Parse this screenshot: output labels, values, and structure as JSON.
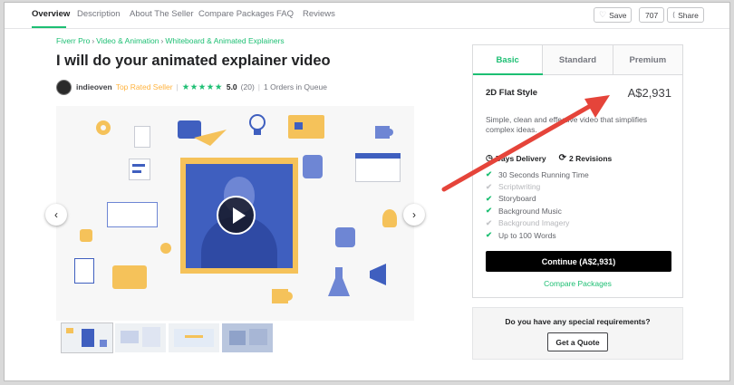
{
  "nav": {
    "tabs": [
      "Overview",
      "Description",
      "About The Seller",
      "Compare Packages",
      "FAQ",
      "Reviews"
    ],
    "save_label": "Save",
    "count": "707",
    "share_label": "Share"
  },
  "breadcrumb": [
    "Fiverr Pro",
    "Video & Animation",
    "Whiteboard & Animated Explainers"
  ],
  "title": "I will do your animated explainer video",
  "seller": {
    "name": "indieoven",
    "level": "Top Rated Seller",
    "stars": "★★★★★",
    "rating": "5.0",
    "reviews": "(20)",
    "queue": "1 Orders in Queue"
  },
  "package": {
    "tabs": [
      "Basic",
      "Standard",
      "Premium"
    ],
    "name": "2D Flat Style",
    "price": "A$2,931",
    "description": "Simple, clean and effective video that simplifies complex ideas.",
    "delivery": "Days Delivery",
    "revisions": "2 Revisions",
    "features": [
      {
        "label": "30 Seconds Running Time",
        "included": true
      },
      {
        "label": "Scriptwriting",
        "included": false
      },
      {
        "label": "Storyboard",
        "included": true
      },
      {
        "label": "Background Music",
        "included": true
      },
      {
        "label": "Background Imagery",
        "included": false
      },
      {
        "label": "Up to 100 Words",
        "included": true
      }
    ],
    "continue_label": "Continue (A$2,931)",
    "compare_label": "Compare Packages"
  },
  "quote": {
    "question": "Do you have any special requirements?",
    "button_label": "Get a Quote"
  },
  "colors": {
    "accent": "#1dbf73",
    "top_rated": "#ffb33e",
    "annotation_arrow": "#e5443a"
  }
}
